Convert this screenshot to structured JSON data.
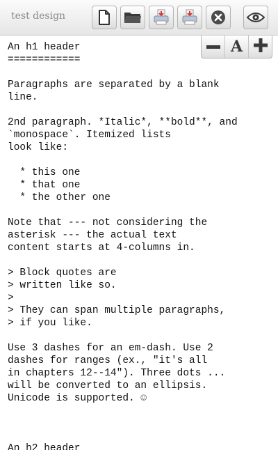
{
  "app": {
    "title": "test design"
  },
  "toolbar": {
    "buttons": [
      {
        "name": "new-document",
        "icon": "new-document-icon"
      },
      {
        "name": "open-folder",
        "icon": "folder-icon"
      },
      {
        "name": "export-a",
        "icon": "print-export-icon"
      },
      {
        "name": "export-b",
        "icon": "print-export-icon"
      },
      {
        "name": "close",
        "icon": "close-icon"
      },
      {
        "name": "preview",
        "icon": "eye-icon"
      }
    ]
  },
  "font_controls": {
    "decrease": "−",
    "font": "A",
    "increase": "+"
  },
  "editor": {
    "text": "An h1 header\n============\n\nParagraphs are separated by a blank\nline.\n\n2nd paragraph. *Italic*, **bold**, and\n`monospace`. Itemized lists\nlook like:\n\n  * this one\n  * that one\n  * the other one\n\nNote that --- not considering the\nasterisk --- the actual text\ncontent starts at 4-columns in.\n\n> Block quotes are\n> written like so.\n>\n> They can span multiple paragraphs,\n> if you like.\n\nUse 3 dashes for an em-dash. Use 2\ndashes for ranges (ex., \"it's all\nin chapters 12--14\"). Three dots ...\nwill be converted to an ellipsis.\nUnicode is supported. ☺\n\n\n\nAn h2 header"
  }
}
